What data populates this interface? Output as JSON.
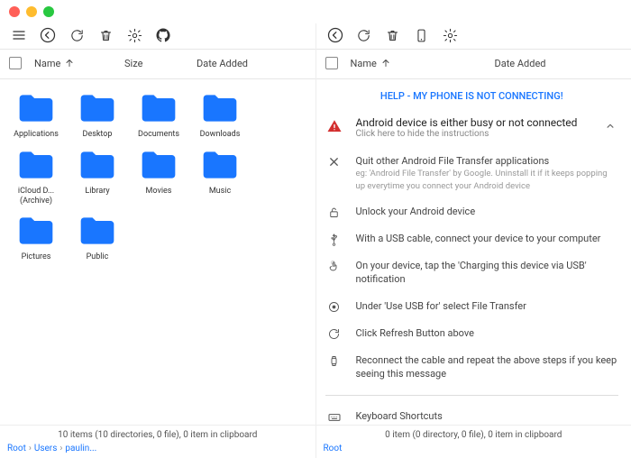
{
  "left": {
    "columns": {
      "name": "Name",
      "size": "Size",
      "date": "Date Added"
    },
    "folders": [
      {
        "label": "Applications"
      },
      {
        "label": "Desktop"
      },
      {
        "label": "Documents"
      },
      {
        "label": "Downloads"
      },
      {
        "label": "iCloud D... (Archive)"
      },
      {
        "label": "Library"
      },
      {
        "label": "Movies"
      },
      {
        "label": "Music"
      },
      {
        "label": "Pictures"
      },
      {
        "label": "Public"
      }
    ],
    "status": "10 items (10 directories, 0 file), 0 item in clipboard",
    "crumbs": [
      "Root",
      "Users",
      "paulin..."
    ]
  },
  "right": {
    "columns": {
      "name": "Name",
      "date": "Date Added"
    },
    "help_link": "HELP - MY PHONE IS NOT CONNECTING!",
    "alert": {
      "title": "Android device is either busy or not connected",
      "sub": "Click here to hide the instructions"
    },
    "instructions": [
      {
        "icon": "close-icon",
        "title": "Quit other Android File Transfer applications",
        "sub": "eg: 'Android File Transfer' by Google. Uninstall it if it keeps popping up everytime you connect your Android device"
      },
      {
        "icon": "lock-icon",
        "title": "Unlock your Android device"
      },
      {
        "icon": "usb-icon",
        "title": "With a USB cable, connect your device to your computer"
      },
      {
        "icon": "touch-icon",
        "title": "On your device, tap the 'Charging this device via USB' notification"
      },
      {
        "icon": "radio-icon",
        "title": "Under 'Use USB for' select File Transfer"
      },
      {
        "icon": "refresh-icon",
        "title": "Click Refresh Button above"
      },
      {
        "icon": "watch-icon",
        "title": "Reconnect the cable and repeat the above steps if you keep seeing this message"
      }
    ],
    "shortcuts": "Keyboard Shortcuts",
    "status": "0 item (0 directory, 0 file), 0 item in clipboard",
    "crumbs": [
      "Root"
    ]
  }
}
